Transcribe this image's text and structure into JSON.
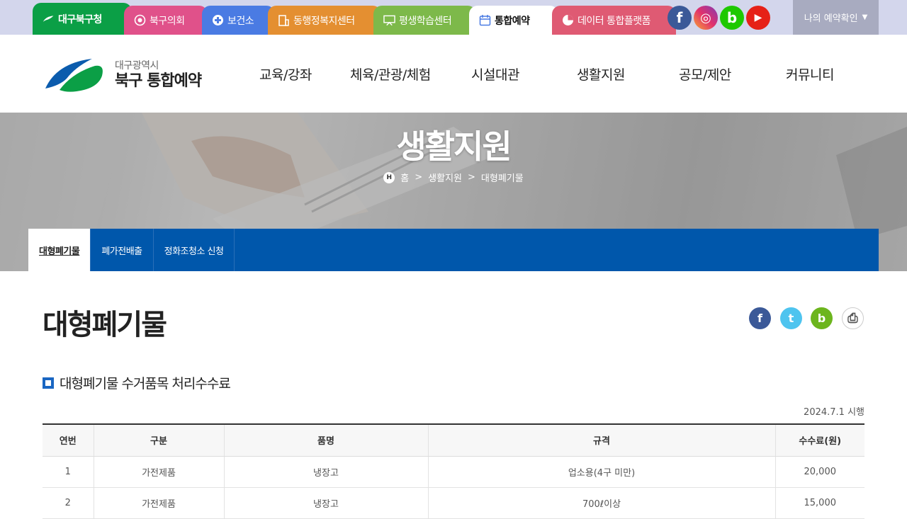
{
  "topbar": {
    "tabs": [
      {
        "label": "대구북구청"
      },
      {
        "label": "북구의회"
      },
      {
        "label": "보건소"
      },
      {
        "label": "동행정복지센터"
      },
      {
        "label": "평생학습센터"
      },
      {
        "label": "통합예약"
      },
      {
        "label": "데이터 통합플랫폼"
      }
    ],
    "sns": [
      {
        "name": "facebook",
        "glyph": "f",
        "color": "#3b5998"
      },
      {
        "name": "instagram",
        "glyph": "◎",
        "color": "#e1306c"
      },
      {
        "name": "blog",
        "glyph": "b",
        "color": "#1ec800"
      },
      {
        "name": "youtube",
        "glyph": "▶",
        "color": "#e62117"
      }
    ],
    "my_reservation": "나의 예약확인",
    "my_reservation_arrow": "▼"
  },
  "header": {
    "logo_sub": "대구광역시",
    "logo_main": "북구 통합예약",
    "gnb": [
      "교육/강좌",
      "체육/관광/체험",
      "시설대관",
      "생활지원",
      "공모/제안",
      "커뮤니티"
    ]
  },
  "banner": {
    "title": "생활지원",
    "breadcrumb": {
      "home_badge": "H",
      "home": "홈",
      "sep": ">",
      "level1": "생활지원",
      "level2": "대형폐기물"
    }
  },
  "subnav": [
    {
      "label": "대형폐기물",
      "active": true
    },
    {
      "label": "폐가전배출",
      "active": false
    },
    {
      "label": "정화조청소 신청",
      "active": false
    }
  ],
  "content": {
    "page_title": "대형폐기물",
    "share": [
      {
        "name": "facebook",
        "glyph": "f",
        "color": "#3b5998"
      },
      {
        "name": "twitter",
        "glyph": "t",
        "color": "#4ec4ef"
      },
      {
        "name": "blog",
        "glyph": "b",
        "color": "#6cb51d"
      },
      {
        "name": "print",
        "glyph": "⎙",
        "color": "#ffffff"
      }
    ],
    "section_title": "대형폐기물 수거품목 처리수수료",
    "effective_date": "2024.7.1 시행",
    "table": {
      "headers": [
        "연번",
        "구분",
        "품명",
        "규격",
        "수수료(원)"
      ],
      "rows": [
        [
          "1",
          "가전제품",
          "냉장고",
          "업소용(4구 미만)",
          "20,000"
        ],
        [
          "2",
          "가전제품",
          "냉장고",
          "700ℓ이상",
          "15,000"
        ]
      ]
    }
  }
}
